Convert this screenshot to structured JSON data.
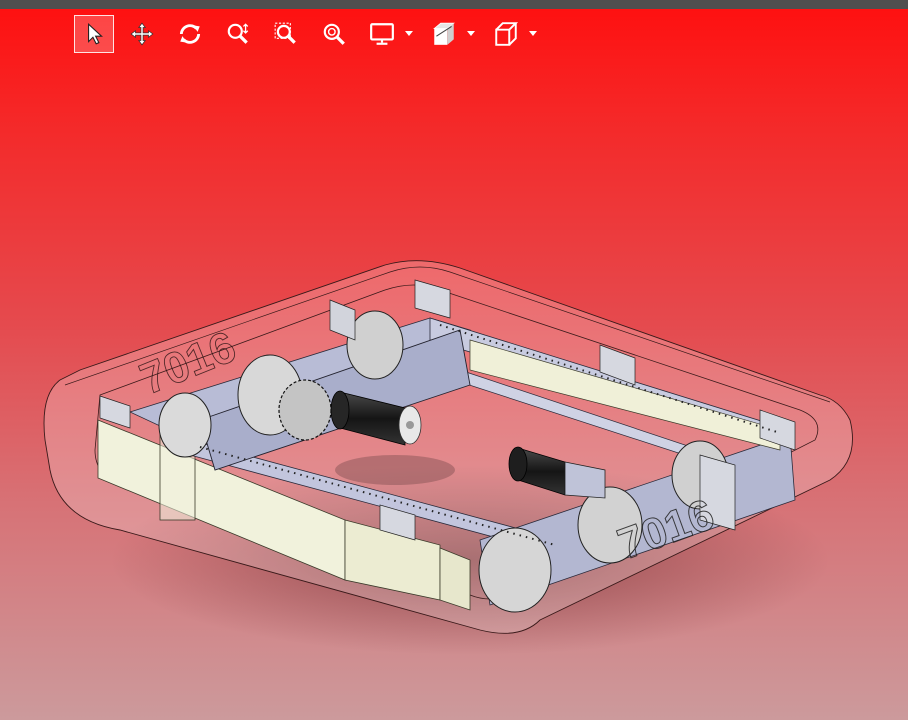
{
  "toolbar": {
    "tools": [
      {
        "name": "select",
        "icon": "cursor-arrow-icon",
        "active": true
      },
      {
        "name": "pan",
        "icon": "move-arrows-icon",
        "active": false
      },
      {
        "name": "rotate",
        "icon": "rotate-icon",
        "active": false
      },
      {
        "name": "zoom",
        "icon": "zoom-icon",
        "active": false
      },
      {
        "name": "zoom-area",
        "icon": "zoom-window-icon",
        "active": false
      },
      {
        "name": "zoom-fit",
        "icon": "zoom-fit-icon",
        "active": false
      },
      {
        "name": "display",
        "icon": "monitor-icon",
        "dropdown": true
      },
      {
        "name": "section",
        "icon": "section-view-icon",
        "dropdown": true
      },
      {
        "name": "view-orientation",
        "icon": "cube-icon",
        "dropdown": true
      }
    ]
  },
  "viewport": {
    "background_top": "#ff0f0f",
    "background_bottom": "#cc9a9c",
    "bumper_text_left": "7016",
    "bumper_text_right": "7016"
  }
}
